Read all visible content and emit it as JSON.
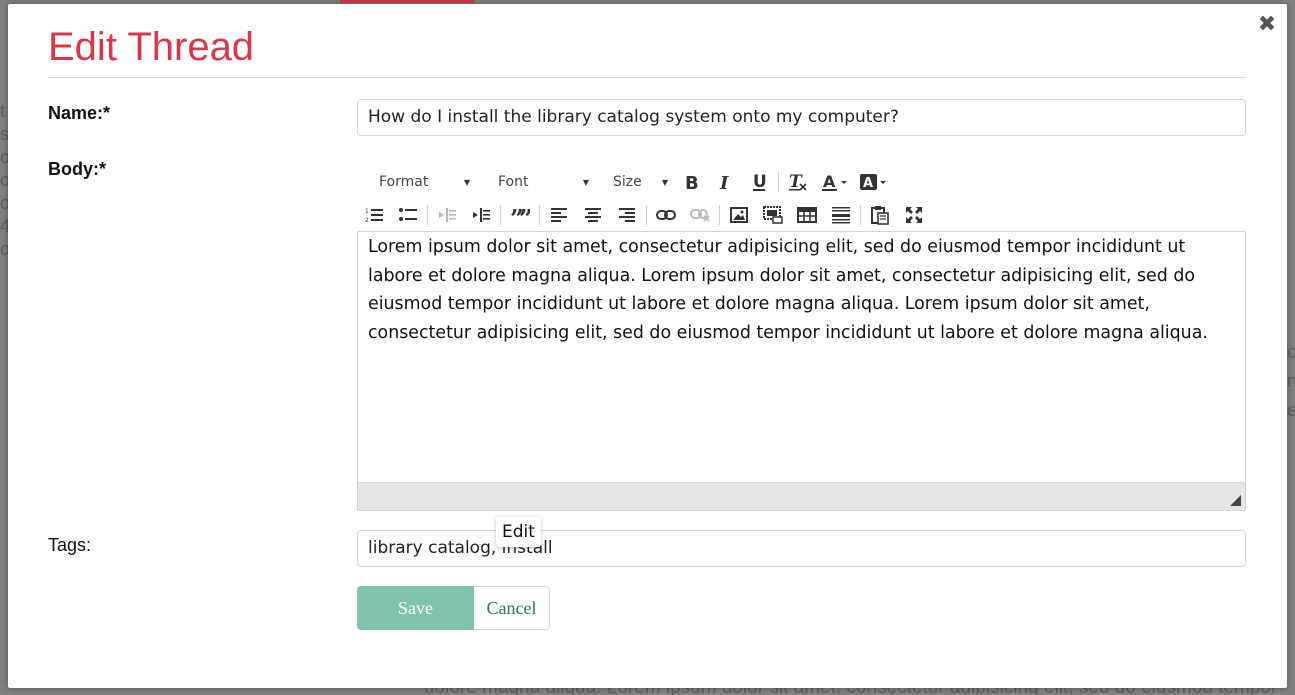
{
  "background": {
    "left_text": "t s o o o 4 o",
    "right_text": "o n e",
    "bottom_text": "dolore magna aliqua. Lorem ipsum dolor sit amet, consectetur adipisicing elit, sed do eiusmod tempor"
  },
  "modal": {
    "title": "Edit Thread",
    "close_glyph": "✖"
  },
  "form": {
    "name_label": "Name:*",
    "name_value": "How do I install the library catalog system onto my computer?",
    "body_label": "Body:*",
    "tags_label": "Tags:",
    "tags_value": "library catalog, install"
  },
  "toolbar": {
    "format_label": "Format",
    "font_label": "Font",
    "size_label": "Size",
    "caret": "▼"
  },
  "editor": {
    "content": "Lorem ipsum dolor sit amet, consectetur adipisicing elit, sed do eiusmod tempor incididunt ut labore et dolore magna aliqua. Lorem ipsum dolor sit amet, consectetur adipisicing elit, sed do eiusmod tempor incididunt ut labore et dolore magna aliqua. Lorem ipsum dolor sit amet, consectetur adipisicing elit, sed do eiusmod tempor incididunt ut labore et dolore magna aliqua."
  },
  "tooltip": {
    "text": "Edit"
  },
  "buttons": {
    "save_label": "Save",
    "cancel_label": "Cancel"
  },
  "colors": {
    "accent": "#d9364a",
    "save_bg": "#7fc4aa",
    "cancel_text": "#1f7b55"
  }
}
